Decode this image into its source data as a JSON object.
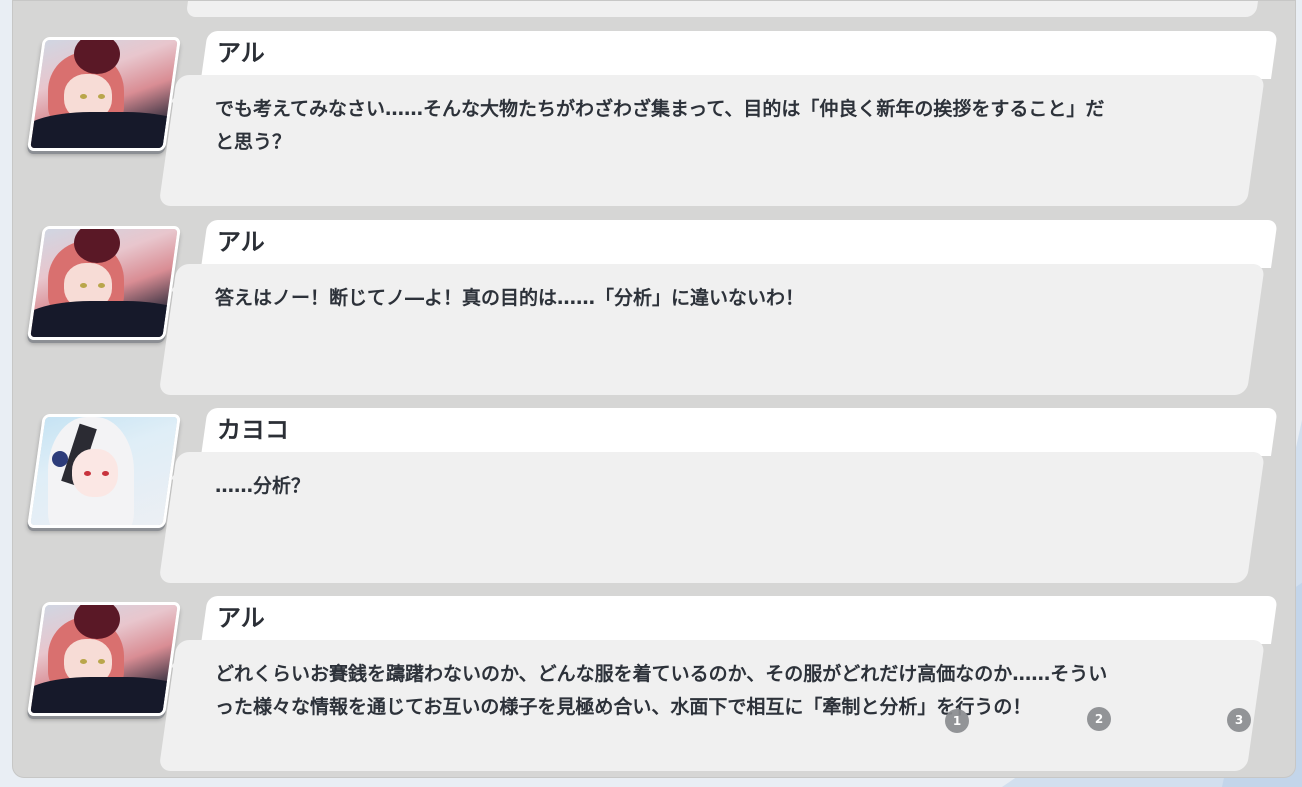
{
  "log": {
    "entries": [
      {
        "speaker": "アル",
        "avatar_icon": "aru-portrait-icon",
        "text": "でも考えてみなさい……そんな大物たちがわざわざ集まって、目的は「仲良く新年の挨拶をすること」だと思う？"
      },
      {
        "speaker": "アル",
        "avatar_icon": "aru-portrait-icon",
        "text": "答えはノー！断じてノ―よ！真の目的は……「分析」に違いないわ！"
      },
      {
        "speaker": "カヨコ",
        "avatar_icon": "kayoko-portrait-icon",
        "text": "……分析？"
      },
      {
        "speaker": "アル",
        "avatar_icon": "aru-portrait-icon",
        "text": "どれくらいお賽銭を躊躇わないのか、どんな服を着ているのか、その服がどれだけ高価なのか……そういった様々な情報を通じてお互いの様子を見極め合い、水面下で相互に「牽制と分析」を行うの！"
      }
    ]
  },
  "choices": [
    "1",
    "2",
    "3"
  ],
  "colors": {
    "panel": "#d6d6d5",
    "bubble": "#f0f0f0",
    "nameplate": "#ffffff",
    "text": "#2d323a",
    "badge": "#8b8d90"
  }
}
